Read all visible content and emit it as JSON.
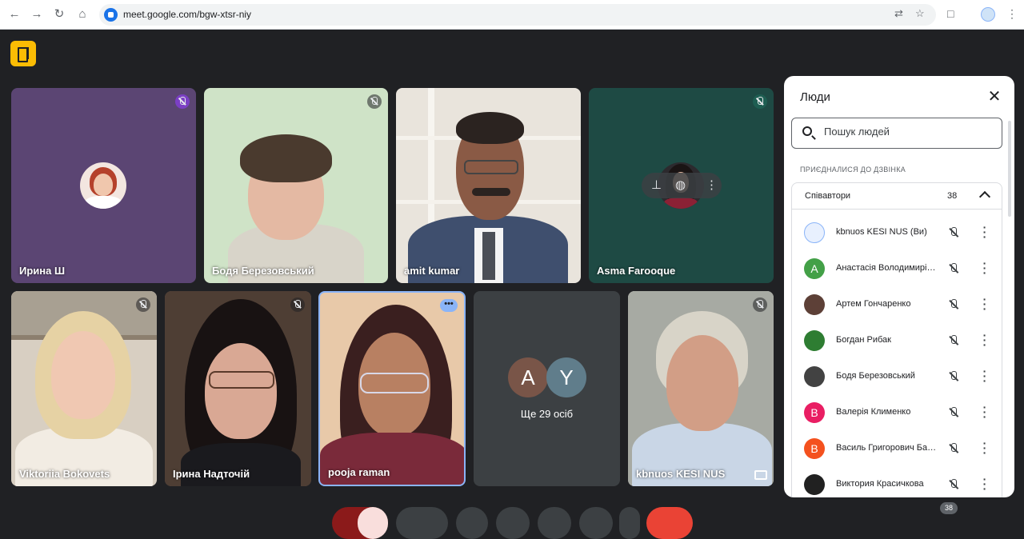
{
  "browser": {
    "url": "meet.google.com/bgw-xtsr-niy"
  },
  "tiles": [
    {
      "name": "Ирина Ш",
      "muted": true
    },
    {
      "name": "Бодя Березовський",
      "muted": true
    },
    {
      "name": "amit kumar",
      "muted": false
    },
    {
      "name": "Asma Farooque",
      "muted": true
    },
    {
      "name": "Viktoriia Bokovets",
      "muted": true
    },
    {
      "name": "Ірина Надточій",
      "muted": true
    },
    {
      "name": "pooja raman",
      "muted": false
    },
    {
      "name": "kbnuos KESI NUS",
      "muted": true
    }
  ],
  "others_tile": {
    "label": "Ще 29 осіб",
    "avatars": [
      {
        "letter": "A",
        "color": "#795548"
      },
      {
        "letter": "Y",
        "color": "#607d8b"
      }
    ]
  },
  "people_panel": {
    "title": "Люди",
    "search_placeholder": "Пошук людей",
    "section_label": "ПРИЄДНАЛИСЯ ДО ДЗВІНКА",
    "group": {
      "title": "Співавтори",
      "count": "38"
    },
    "people": [
      {
        "name": "kbnuos KESI NUS (Ви)",
        "letter": "",
        "color": "#e8f0fe"
      },
      {
        "name": "Анастасія Володимирівна",
        "letter": "А",
        "color": "#43a047"
      },
      {
        "name": "Артем Гончаренко",
        "letter": "",
        "color": "#5d4037"
      },
      {
        "name": "Богдан Рибак",
        "letter": "",
        "color": "#2e7d32"
      },
      {
        "name": "Бодя Березовський",
        "letter": "",
        "color": "#424242"
      },
      {
        "name": "Валерія Клименко",
        "letter": "В",
        "color": "#e91e63"
      },
      {
        "name": "Василь Григорович Бабенко",
        "letter": "В",
        "color": "#f4511e"
      },
      {
        "name": "Виктория Красичкова",
        "letter": "",
        "color": "#212121"
      }
    ]
  },
  "participant_count_badge": "38"
}
